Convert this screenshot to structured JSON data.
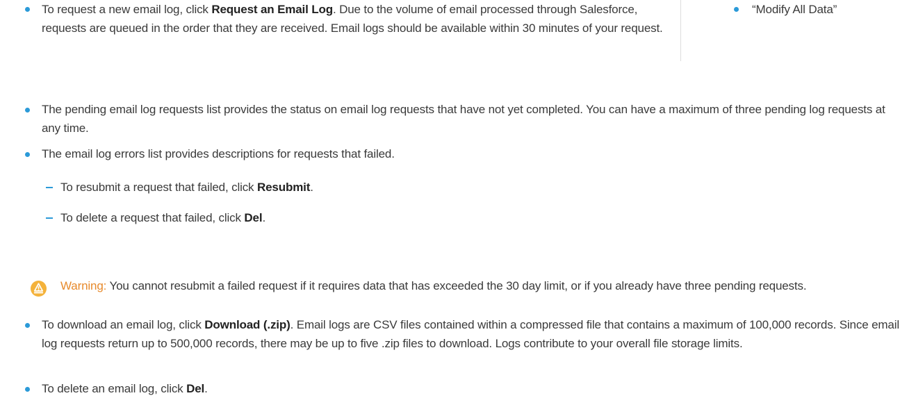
{
  "items": {
    "request_log": {
      "pre": "To request a new email log, click ",
      "bold": "Request an Email Log",
      "post": ". Due to the volume of email processed through Salesforce, requests are queued in the order that they are received. Email logs should be available within 30 minutes of your request."
    },
    "pending": {
      "text": "The pending email log requests list provides the status on email log requests that have not yet completed. You can have a maximum of three pending log requests at any time."
    },
    "errors": {
      "text": "The email log errors list provides descriptions for requests that failed."
    },
    "resubmit": {
      "pre": "To resubmit a request that failed, click ",
      "bold": "Resubmit",
      "post": "."
    },
    "delete_failed": {
      "pre": "To delete a request that failed, click ",
      "bold": "Del",
      "post": "."
    },
    "warning": {
      "label": "Warning:",
      "text": " You cannot resubmit a failed request if it requires data that has exceeded the 30 day limit, or if you already have three pending requests."
    },
    "download": {
      "pre": "To download an email log, click ",
      "bold": "Download (.zip)",
      "post": ". Email logs are CSV files contained within a compressed file that contains a maximum of 100,000 records. Since email log requests return up to 500,000 records, there may be up to five .zip files to download. Logs contribute to your overall file storage limits."
    },
    "delete_log": {
      "pre": "To delete an email log, click ",
      "bold": "Del",
      "post": "."
    }
  },
  "sidebar": {
    "permission": "“Modify All Data”"
  },
  "colors": {
    "bullet": "#2b9ad8",
    "warning": "#e78a2c",
    "warning_icon_bg": "#f4b23a"
  },
  "icons": {
    "warning": "warning-icon"
  }
}
